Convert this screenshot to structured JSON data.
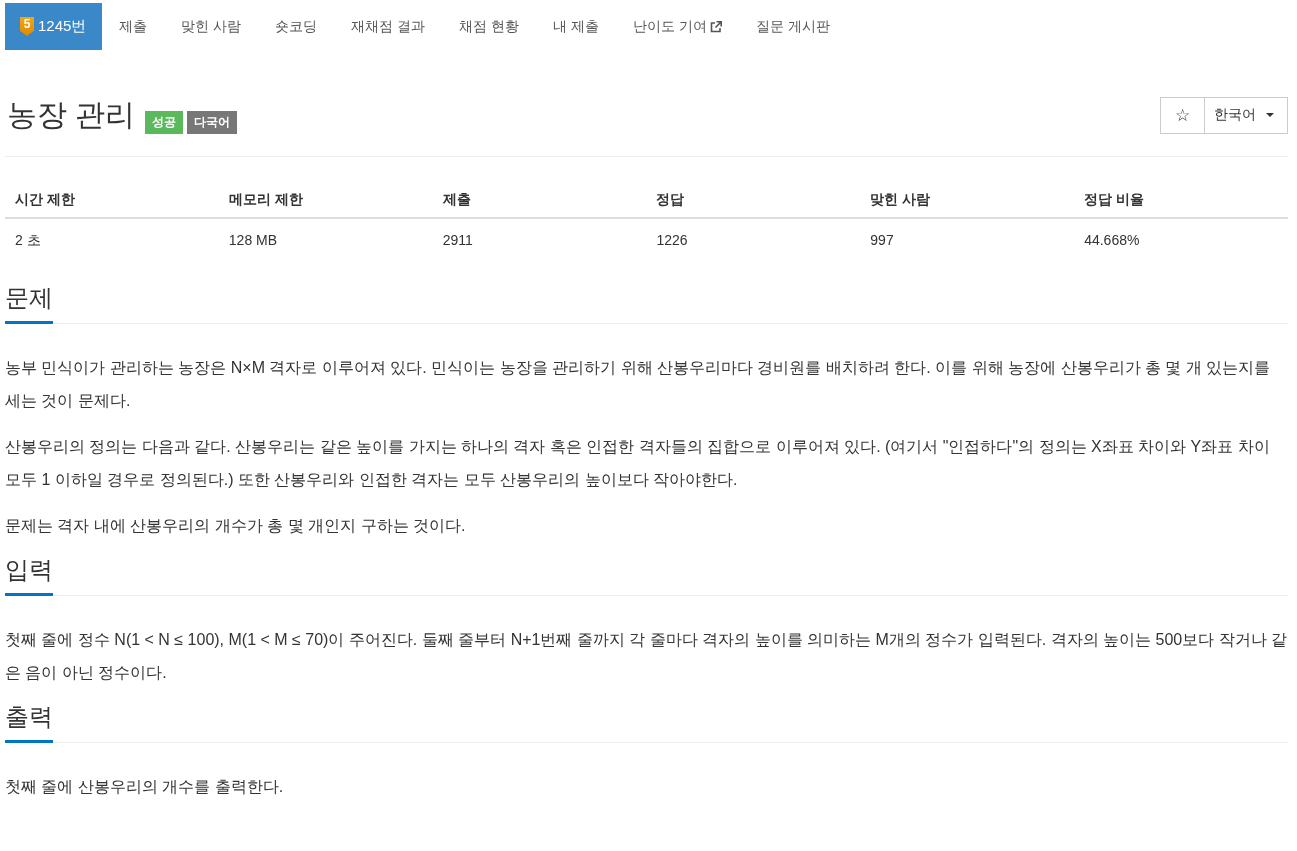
{
  "nav_tabs": [
    {
      "label": "1245번",
      "selected": true,
      "tier": "5",
      "external": false
    },
    {
      "label": "제출",
      "selected": false,
      "external": false
    },
    {
      "label": "맞힌 사람",
      "selected": false,
      "external": false
    },
    {
      "label": "숏코딩",
      "selected": false,
      "external": false
    },
    {
      "label": "재채점 결과",
      "selected": false,
      "external": false
    },
    {
      "label": "채점 현황",
      "selected": false,
      "external": false
    },
    {
      "label": "내 제출",
      "selected": false,
      "external": false
    },
    {
      "label": "난이도 기여",
      "selected": false,
      "external": true
    },
    {
      "label": "질문 게시판",
      "selected": false,
      "external": false
    }
  ],
  "problem": {
    "title": "농장 관리",
    "labels": [
      {
        "text": "성공",
        "color": "#5cb85c"
      },
      {
        "text": "다국어",
        "color": "#777777"
      }
    ]
  },
  "toolbar": {
    "star": "☆",
    "language": "한국어"
  },
  "limits_table": {
    "columns": [
      "시간 제한",
      "메모리 제한",
      "제출",
      "정답",
      "맞힌 사람",
      "정답 비율"
    ],
    "rows": [
      [
        "2 초",
        "128 MB",
        "2911",
        "1226",
        "997",
        "44.668%"
      ]
    ]
  },
  "sections": [
    {
      "heading": "문제",
      "paragraphs": [
        "농부 민식이가 관리하는 농장은 N×M 격자로 이루어져 있다. 민식이는 농장을 관리하기 위해 산봉우리마다 경비원를 배치하려 한다. 이를 위해 농장에 산봉우리가 총 몇 개 있는지를 세는 것이 문제다.",
        "산봉우리의 정의는 다음과 같다. 산봉우리는 같은 높이를 가지는 하나의 격자 혹은 인접한 격자들의 집합으로 이루어져 있다. (여기서 \"인접하다\"의 정의는 X좌표 차이와 Y좌표 차이 모두 1 이하일 경우로 정의된다.) 또한 산봉우리와 인접한 격자는 모두 산봉우리의 높이보다 작아야한다.",
        "문제는 격자 내에 산봉우리의 개수가 총 몇 개인지 구하는 것이다."
      ]
    },
    {
      "heading": "입력",
      "paragraphs": [
        "첫째 줄에 정수 N(1 < N ≤ 100), M(1 < M ≤ 70)이 주어진다. 둘째 줄부터 N+1번째 줄까지 각 줄마다 격자의 높이를 의미하는 M개의 정수가 입력된다. 격자의 높이는 500보다 작거나 같은 음이 아닌 정수이다."
      ]
    },
    {
      "heading": "출력",
      "paragraphs": [
        "첫째 줄에 산봉우리의 개수를 출력한다."
      ]
    }
  ]
}
